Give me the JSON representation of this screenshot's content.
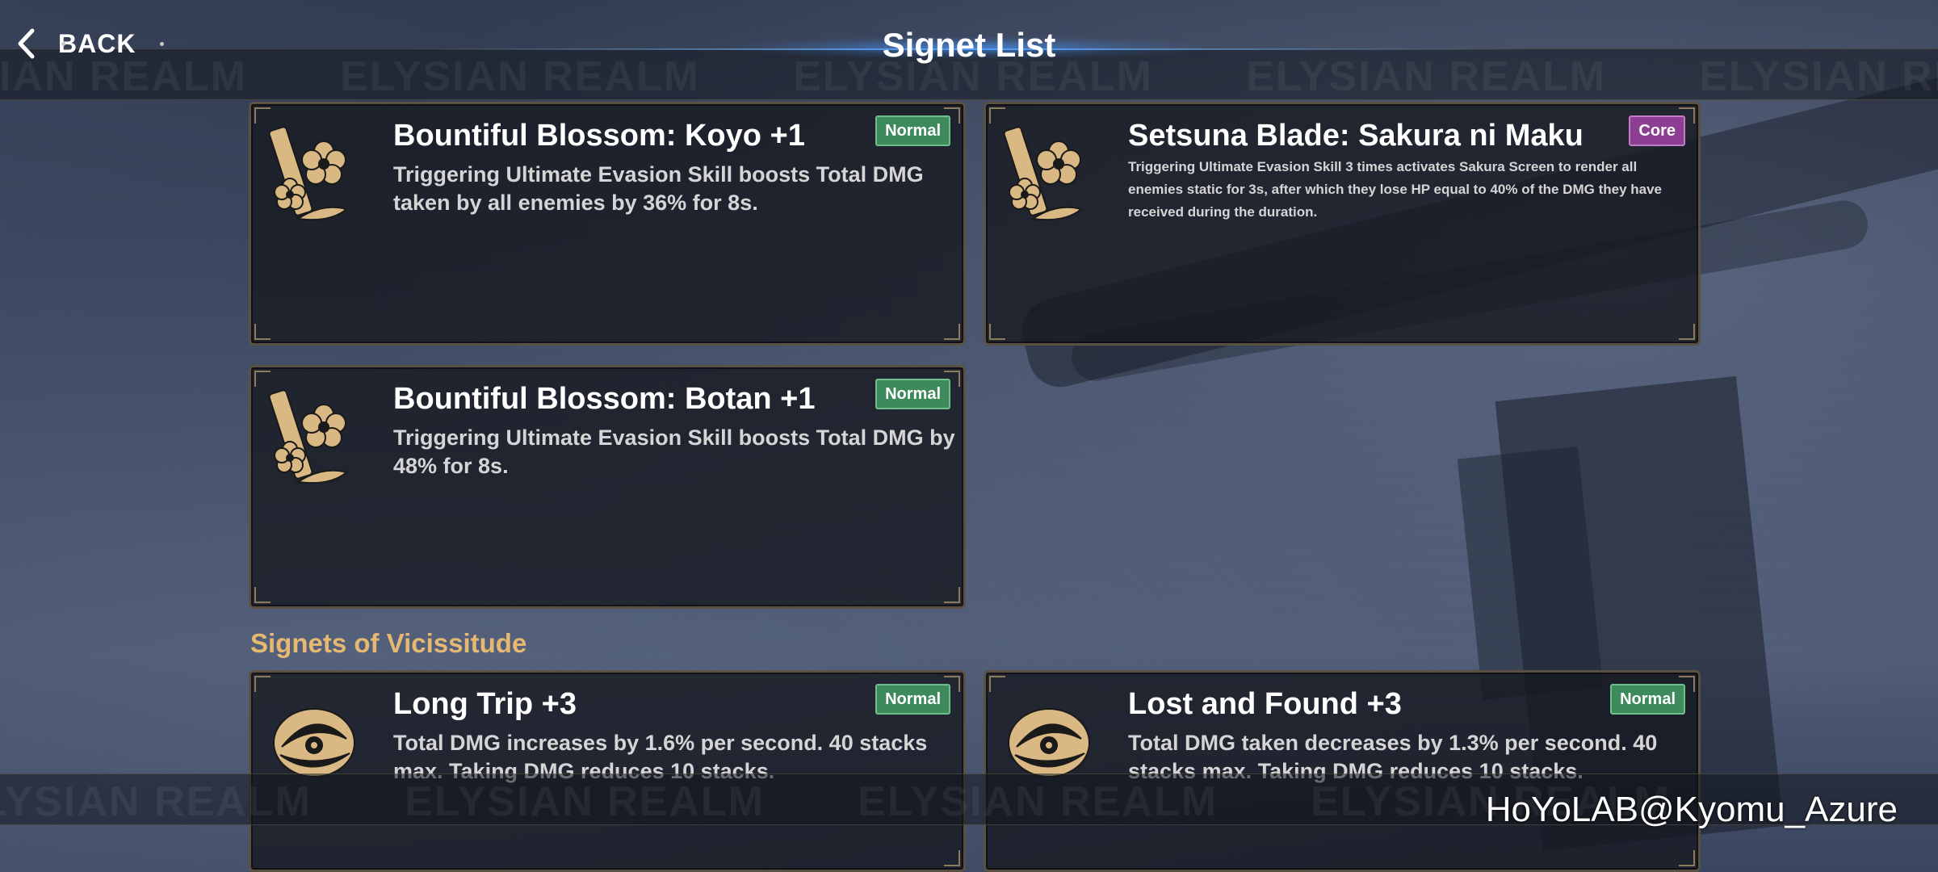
{
  "header": {
    "back_label": "BACK",
    "title": "Signet List",
    "banner_text": "ELYSIAN REALM"
  },
  "cards": [
    {
      "name": "Bountiful Blossom: Koyo +1",
      "badge": "Normal",
      "description": "Triggering Ultimate Evasion Skill boosts Total DMG taken by all enemies by 36% for 8s.",
      "icon": "sakura-blade-icon"
    },
    {
      "name": "Setsuna Blade: Sakura ni Maku",
      "badge": "Core",
      "description": "Triggering Ultimate Evasion Skill 3 times activates Sakura Screen to render all enemies static for 3s, after which they lose HP equal to 40% of the DMG they have received during the duration.",
      "icon": "sakura-blade-icon"
    },
    {
      "name": "Bountiful Blossom: Botan +1",
      "badge": "Normal",
      "description": "Triggering Ultimate Evasion Skill boosts Total DMG by 48% for 8s.",
      "icon": "sakura-blade-icon"
    }
  ],
  "section": {
    "heading": "Signets of Vicissitude"
  },
  "vicissitude_cards": [
    {
      "name": "Long Trip +3",
      "badge": "Normal",
      "description": "Total DMG increases by 1.6% per second. 40 stacks max. Taking DMG reduces 10 stacks.",
      "icon": "vicissitude-emblem-icon"
    },
    {
      "name": "Lost and Found +3",
      "badge": "Normal",
      "description": "Total DMG taken decreases by 1.3% per second. 40 stacks max. Taking DMG reduces 10 stacks.",
      "icon": "vicissitude-emblem-icon"
    }
  ],
  "watermark": "HoYoLAB@Kyomu_Azure",
  "colors": {
    "normal_badge": "#3d8a5c",
    "core_badge": "#8b3e92",
    "section_heading": "#e6b870",
    "icon_gold": "#d9b883"
  }
}
